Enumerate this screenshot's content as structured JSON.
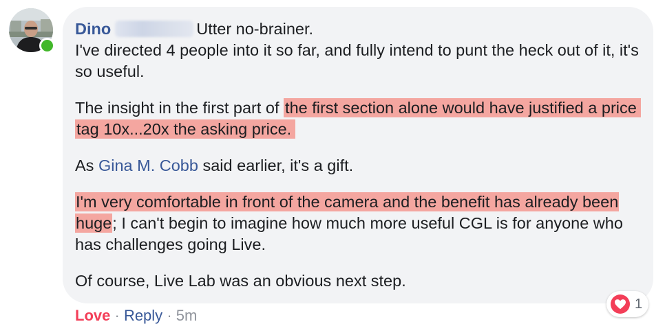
{
  "comment": {
    "author": "Dino",
    "first_line": "Utter no-brainer.",
    "line_two": "I've directed 4 people into it so far, and fully intend to punt the heck out of it, it's so useful.",
    "para2_plain": "The insight in the first part of ",
    "para2_highlight": "the first section alone would have justified a price tag 10x...20x the asking price.",
    "para3_before": "As ",
    "para3_mention": "Gina M. Cobb",
    "para3_after": " said earlier, it's a gift.",
    "para4_highlight": "I'm very comfortable in front of the camera and the benefit has already been huge",
    "para4_plain": "; I can't begin to imagine how much more useful CGL is for anyone who has challenges going Live.",
    "para5": "Of course, Live Lab was an obvious next step."
  },
  "actions": {
    "love_label": "Love",
    "separator": "·",
    "reply_label": "Reply",
    "timestamp": "5m"
  },
  "reactions": {
    "icon": "heart-icon",
    "count": "1"
  },
  "colors": {
    "author_link": "#385898",
    "highlight": "#f4a6a0",
    "love": "#f33e58",
    "bubble": "#f2f3f5",
    "online": "#42b72a"
  }
}
